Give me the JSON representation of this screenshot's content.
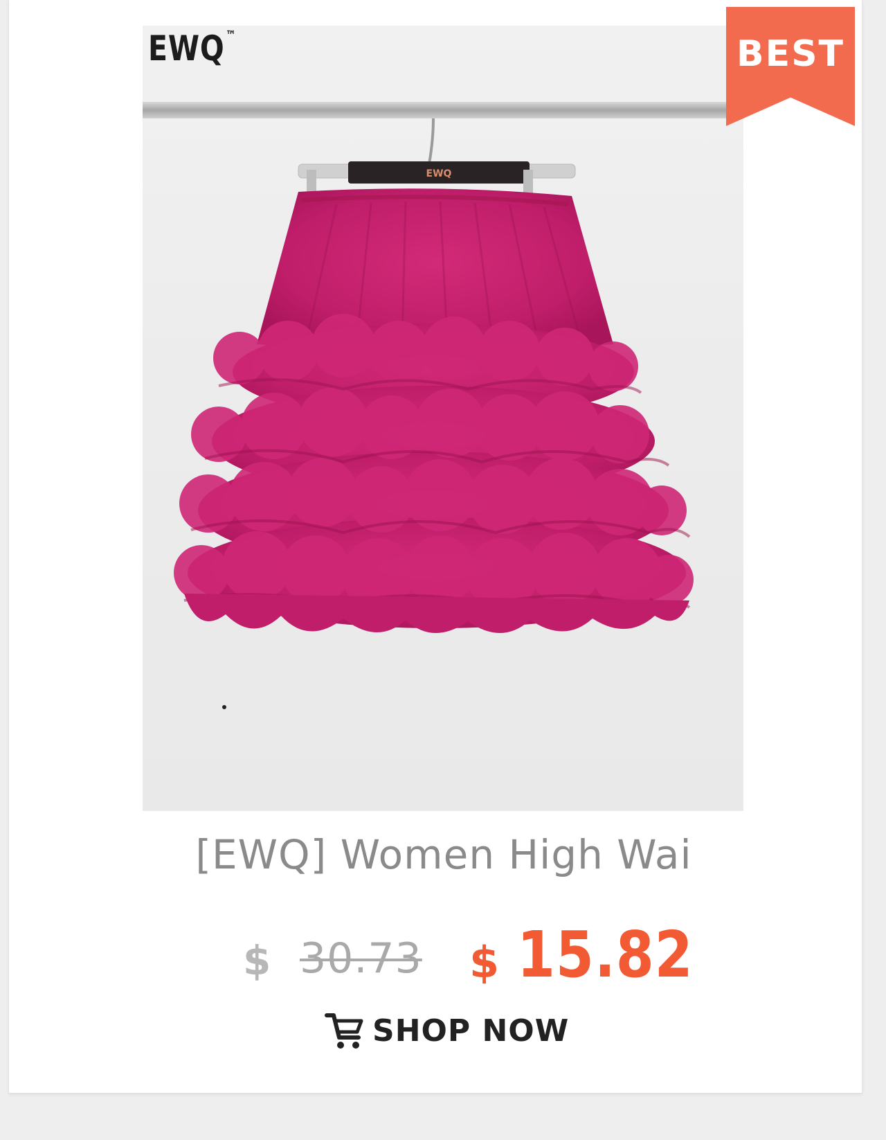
{
  "product": {
    "brand_logo": "EWQ",
    "brand_logo_mark": "™",
    "hanger_brand": "EWQ",
    "badge": "BEST",
    "title": "[EWQ] Women High Wai",
    "old_currency": "$",
    "old_price": "30.73",
    "new_currency": "$",
    "new_price": "15.82",
    "shop_label": "SHOP NOW",
    "icons": {
      "cart": "shopping-cart-icon"
    },
    "colors": {
      "badge": "#f26b4f",
      "price": "#f15a32",
      "skirt": "#c01e6a"
    }
  }
}
